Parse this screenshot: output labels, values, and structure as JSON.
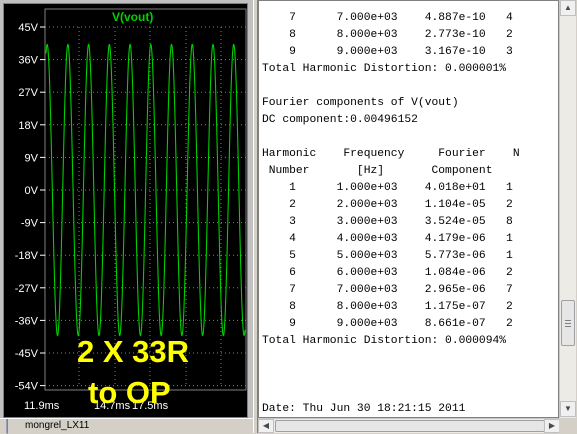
{
  "waveform": {
    "trace_name": "V(vout)",
    "y_ticks": [
      "45V",
      "36V",
      "27V",
      "18V",
      "9V",
      "0V",
      "-9V",
      "-18V",
      "-27V",
      "-36V",
      "-45V",
      "-54V"
    ],
    "x_ticks": [
      "11.9ms",
      "14.7ms",
      "17.5ms"
    ],
    "overlay_line1": "2 X 33R",
    "overlay_line2": "to OP",
    "trace_color": "#00d000",
    "grid_color": "#808080",
    "background": "#000000",
    "cycles_shown": 9.6,
    "amplitude_v": 40.18,
    "y_range_v": [
      -54,
      45
    ]
  },
  "status": {
    "icon": "waveform-icon",
    "text": "mongrel_LX11"
  },
  "log": {
    "lines": [
      "    7      7.000e+03    4.887e-10   4",
      "    8      8.000e+03    2.773e-10   2",
      "    9      9.000e+03    3.167e-10   3",
      "Total Harmonic Distortion: 0.000001%",
      "",
      "Fourier components of V(vout)",
      "DC component:0.00496152",
      "",
      "Harmonic    Frequency     Fourier    N",
      " Number       [Hz]       Component",
      "    1      1.000e+03    4.018e+01   1",
      "    2      2.000e+03    1.104e-05   2",
      "    3      3.000e+03    3.524e-05   8",
      "    4      4.000e+03    4.179e-06   1",
      "    5      5.000e+03    5.773e-06   1",
      "    6      6.000e+03    1.084e-06   2",
      "    7      7.000e+03    2.965e-06   7",
      "    8      8.000e+03    1.175e-07   2",
      "    9      9.000e+03    8.661e-07   2",
      "Total Harmonic Distortion: 0.000094%",
      "",
      "",
      "",
      "Date: Thu Jun 30 18:21:15 2011"
    ]
  }
}
